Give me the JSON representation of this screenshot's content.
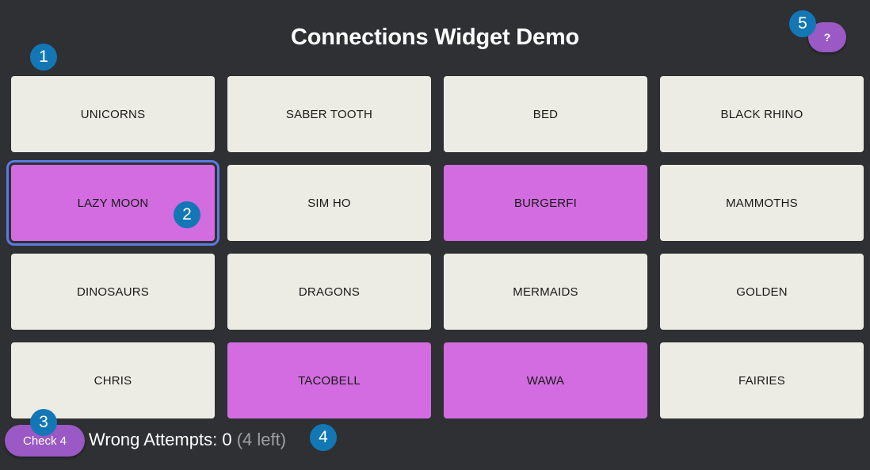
{
  "title": "Connections Widget Demo",
  "help_button": {
    "label": "?"
  },
  "tiles": [
    {
      "label": "UNICORNS",
      "selected": false
    },
    {
      "label": "SABER TOOTH",
      "selected": false
    },
    {
      "label": "BED",
      "selected": false
    },
    {
      "label": "BLACK RHINO",
      "selected": false
    },
    {
      "label": "LAZY MOON",
      "selected": true,
      "focused": true
    },
    {
      "label": "SIM HO",
      "selected": false
    },
    {
      "label": "BURGERFI",
      "selected": true
    },
    {
      "label": "MAMMOTHS",
      "selected": false
    },
    {
      "label": "DINOSAURS",
      "selected": false
    },
    {
      "label": "DRAGONS",
      "selected": false
    },
    {
      "label": "MERMAIDS",
      "selected": false
    },
    {
      "label": "GOLDEN",
      "selected": false
    },
    {
      "label": "CHRIS",
      "selected": false
    },
    {
      "label": "TACOBELL",
      "selected": true
    },
    {
      "label": "WAWA",
      "selected": true
    },
    {
      "label": "FAIRIES",
      "selected": false
    }
  ],
  "check_button": {
    "label": "Check 4"
  },
  "attempts": {
    "label": "Wrong Attempts:",
    "count": "0",
    "left": "(4 left)"
  },
  "badges": [
    "1",
    "2",
    "3",
    "4",
    "5"
  ],
  "colors": {
    "background": "#2e3033",
    "tile": "#ecece4",
    "tile_selected": "#d26ce0",
    "focus_ring": "#5b7be0",
    "button": "#9a59c4",
    "badge": "#1477b5"
  }
}
